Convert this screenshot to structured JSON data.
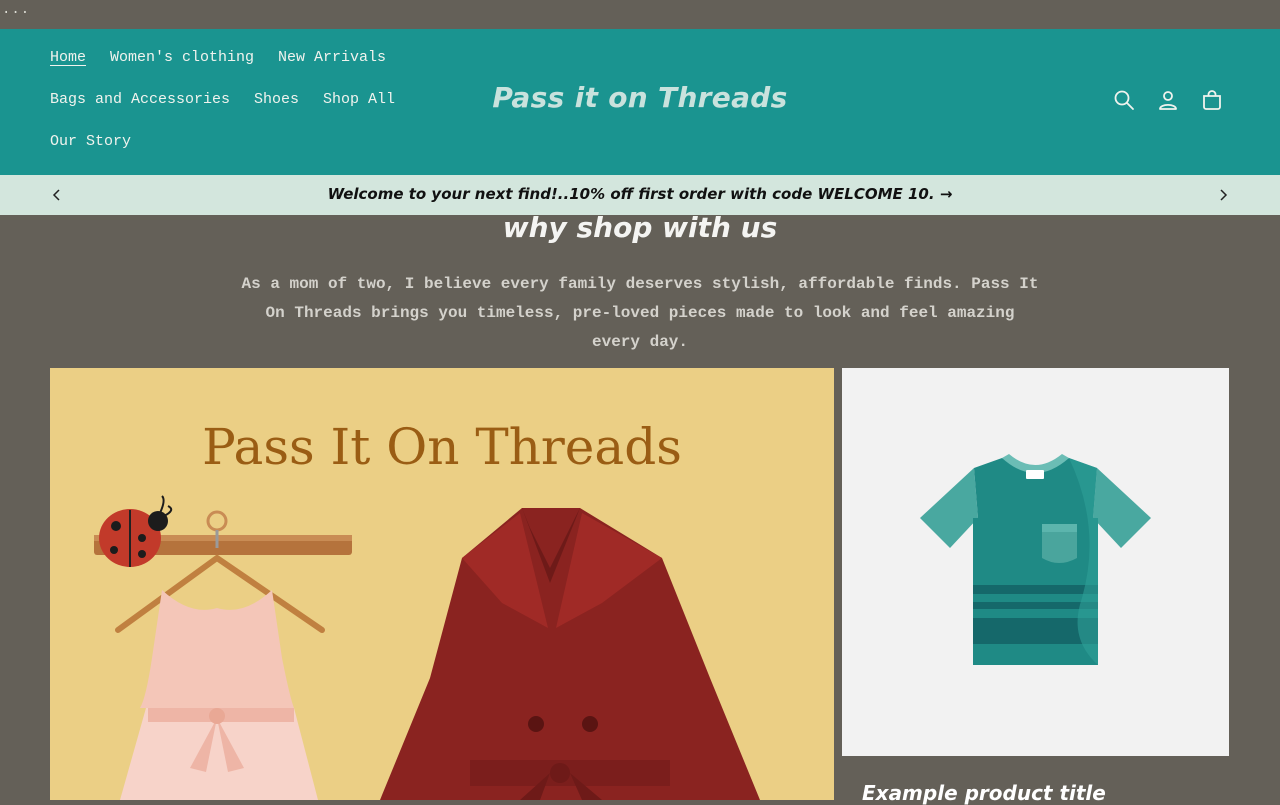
{
  "browser": {
    "menu_dots": "..."
  },
  "header": {
    "brand": "Pass it on Threads",
    "nav": [
      {
        "label": "Home",
        "active": true
      },
      {
        "label": "Women's clothing"
      },
      {
        "label": "New Arrivals"
      },
      {
        "label": "Bags and Accessories"
      },
      {
        "label": "Shoes"
      },
      {
        "label": "Shop All"
      },
      {
        "label": "Our Story"
      }
    ],
    "icons": [
      "search-icon",
      "account-icon",
      "cart-icon"
    ],
    "colors": {
      "background": "#1a9490",
      "brand_text": "#c9e2dd"
    }
  },
  "announcement": {
    "text": "Welcome to your next find!..10% off first order with code WELCOME 10.",
    "arrow_glyph": "→",
    "colors": {
      "background": "#d3e6dd"
    }
  },
  "intro": {
    "title": "why shop with us",
    "body": "As a mom of two, I believe every family deserves stylish, affordable finds. Pass It On Threads brings you timeless, pre-loved pieces made to look and feel amazing every day."
  },
  "hero": {
    "title": "Pass It On Threads",
    "colors": {
      "background": "#ebcf85",
      "title": "#9a5d14"
    }
  },
  "product": {
    "title": "Example product title",
    "image_icon": "tshirt-icon"
  },
  "colors": {
    "page_background": "#646058"
  }
}
